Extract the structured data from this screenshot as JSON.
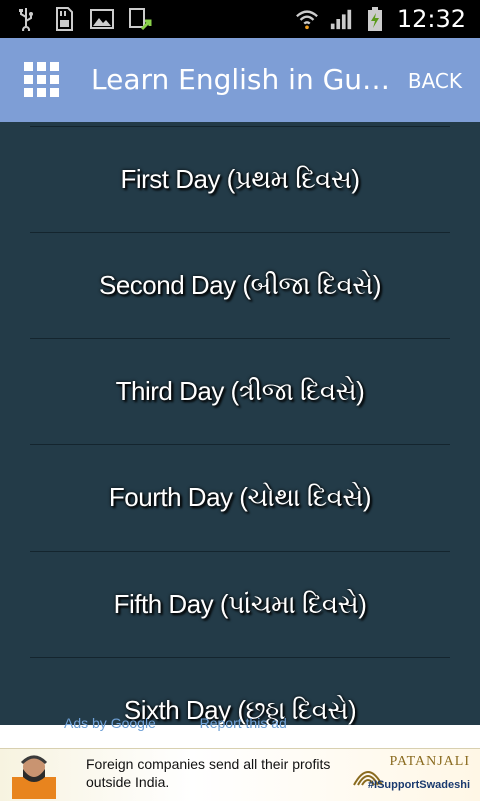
{
  "status_bar": {
    "time": "12:32",
    "left_icons": [
      "usb-icon",
      "sd-card-icon",
      "image-icon",
      "download-icon"
    ],
    "right_icons": [
      "wifi-icon",
      "signal-icon",
      "battery-charging-icon"
    ]
  },
  "action_bar": {
    "title": "Learn English in Guj...",
    "back_label": "BACK",
    "menu_icon": "grid-icon",
    "color": "#7e9ed6"
  },
  "days": [
    {
      "label": "First Day (પ્રથમ દિવસ)"
    },
    {
      "label": "Second Day (બીજા દિવસે)"
    },
    {
      "label": "Third Day (ત્રીજા દિવસે)"
    },
    {
      "label": "Fourth Day (ચોથા દિવસે)"
    },
    {
      "label": "Fifth Day (પાંચમા દિવસે)"
    },
    {
      "label": "Sixth Day (છઠ્ઠા દિવસે)"
    }
  ],
  "ad": {
    "ads_by": "Ads by Google",
    "report": "Report this ad",
    "text": "Foreign companies send all their profits outside India.",
    "brand": "PATANJALI",
    "tag": "#ISupportSwadeshi"
  },
  "colors": {
    "list_background": "#233b48",
    "divider": "#14252e",
    "text": "#ffffff"
  }
}
